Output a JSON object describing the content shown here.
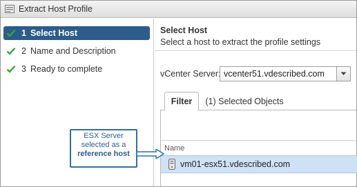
{
  "window": {
    "title": "Extract Host Profile",
    "title_icon": "host-profile-icon"
  },
  "steps": [
    {
      "number": "1",
      "label": "Select Host",
      "state": "active",
      "icon": "check-icon"
    },
    {
      "number": "2",
      "label": "Name and Description",
      "state": "pending",
      "icon": "check-icon"
    },
    {
      "number": "3",
      "label": "Ready to complete",
      "state": "pending",
      "icon": "check-icon"
    }
  ],
  "page": {
    "title": "Select Host",
    "subtitle": "Select a host to extract the profile settings"
  },
  "vcenter": {
    "label": "vCenter Server:",
    "value": "vcenter51.vdescribed.com"
  },
  "tabs": [
    {
      "label": "Filter",
      "selected": true
    },
    {
      "label": "(1) Selected Objects",
      "selected": false
    }
  ],
  "grid": {
    "columns": [
      "Name"
    ],
    "rows": [
      {
        "name": "vm01-esx51.vdescribed.com",
        "icon": "esx-host-icon",
        "selected": true
      }
    ]
  },
  "callout": {
    "line1": "ESX Server",
    "line2": "selected as a",
    "line3": "reference host"
  },
  "colors": {
    "active_step_bg": "#2b5c8a",
    "check_green": "#3aa43a",
    "selected_row_bg": "#cfe2f5",
    "callout_border": "#2f6ea5"
  }
}
